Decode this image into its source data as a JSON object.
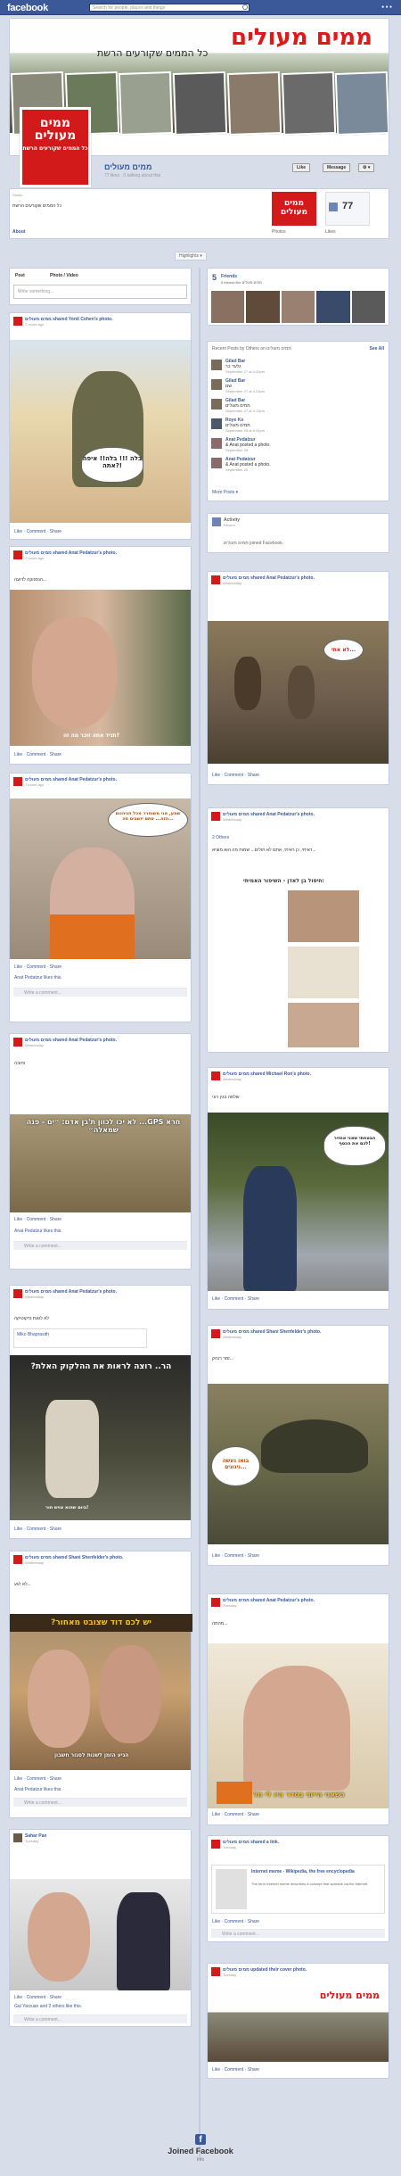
{
  "topbar": {
    "logo": "facebook",
    "search_placeholder": "Search for people, places and things"
  },
  "cover": {
    "title": "ממים מעולים",
    "subtitle": "כל הממים שקורעים הרשת"
  },
  "profile": {
    "line1": "ממים",
    "line2": "מעולים",
    "line3": "כל הממים שקורעים הרשת"
  },
  "page": {
    "name": "ממים מעולים",
    "meta": "77 likes · 0 talking about this",
    "like_btn": "Like",
    "message_btn": "Message",
    "gear": "⚙ ▾",
    "about_label": "About",
    "about_text": "כל הממים שקורעים הרשת",
    "likes_count": "77",
    "photos_label": "Photos",
    "likes_label": "Likes",
    "studio": "Studio"
  },
  "highlights": "Highlights ▾",
  "composer": {
    "tab_post": "Post",
    "tab_photo": "Photo / Video",
    "placeholder": "Write something..."
  },
  "friends": {
    "count": "5",
    "label": "Friends",
    "sub": "5 friends like ממים מעולים"
  },
  "recent": {
    "title": "Recent Posts by Others on ממים מעולים",
    "see_all": "See All",
    "items": [
      {
        "name": "Gilad Bar",
        "text": "גלעד בר",
        "meta": "September 27 at 4:43pm"
      },
      {
        "name": "Gilad Bar",
        "text": "שם",
        "meta": "September 27 at 4:23pm"
      },
      {
        "name": "Gilad Bar",
        "text": "ממים מעולים",
        "meta": "September 27 at 4:13pm"
      },
      {
        "name": "Roye Ko",
        "text": "ממים מעולים",
        "meta": "September 25 at 8:44pm"
      },
      {
        "name": "Anat Pedatzur",
        "text": "& Anat posted a photo.",
        "meta": "September 25"
      },
      {
        "name": "Anat Pedatzur",
        "text": "& Anat posted a photo.",
        "meta": "September 25"
      }
    ],
    "more": "More Posts ▾"
  },
  "activity": {
    "title": "Activity",
    "sub": "Recent",
    "text": "ממים מעולים joined Facebook."
  },
  "posts": [
    {
      "author": "ממים מעולים shared Yonit Cohen's photo.",
      "time": "7 hours ago",
      "bubble": "בלה !!! בלה!! איפה אתה?!",
      "actions": "Like · Comment · Share"
    },
    {
      "author": "ממים מעולים shared Anat Pedatzur's photo.",
      "time": "7 hours ago",
      "text": "הנסנוקה לדועה...",
      "caption": "תגיד אתה זוכר מה זה?",
      "actions": "Like · Comment · Share"
    },
    {
      "author": "ממים מעולים shared Anat Pedatzur's photo.",
      "time": "Wednesday",
      "bubble": "לא אתי...",
      "actions": "Like · Comment · Share"
    },
    {
      "author": "ממים מעולים shared Anat Pedatzur's photo.",
      "time": "7 hours ago",
      "bubble": "שמע, אני משוחרר מכל הגיהנום הזה... סתם יושבים פה...",
      "likes": "Anat Pedatzur likes this.",
      "comment": "Write a comment...",
      "actions": "Like · Comment · Share"
    },
    {
      "author": "ממים מעולים shared Anat Pedatzur's photo.",
      "time": "Wednesday",
      "count": "2 Others",
      "text": "ראיתי, כן ראיתי, אתם לא חולים... שמות מה הוא מוציא...",
      "caption": "חיסול בן לאדן - השיפור האמיתי:",
      "actions": "Like · Comment · Share"
    },
    {
      "author": "ממים מעולים shared Anat Pedatzur's photo.",
      "time": "Wednesday",
      "text": "וחובה",
      "likes": "Anat Pedatzur likes this.",
      "comment": "Write a comment...",
      "caption": "חרא GPS... לא יכו לכוון ת'בן אדם: ״ים - פנה שמאלה״",
      "actions": "Like · Comment · Share"
    },
    {
      "author": "ממים מעולים shared Michael Ron's photo.",
      "time": "Wednesday",
      "text": "שלמה בגין רוני",
      "bubble": "הבטחתי שאני אחזיר לכם את הכסף!",
      "actions": "Like · Comment · Share"
    },
    {
      "author": "ממים מעולים shared Anat Pedatzur's photo.",
      "time": "Wednesday",
      "text": "לא לגעת נרקוטיקה",
      "sub": "Miko Bhaprasith",
      "caption": "הר.. רוצה לראות את ההלקוק האלת?",
      "bottom": "ביום שהוא צויש חור!",
      "actions": "Like · Comment · Share"
    },
    {
      "author": "ממים מעולים shared Shani Shenfelder's photo.",
      "time": "Wednesday",
      "text": "זמר רנהק...",
      "bubble": "בואו נעשה ניגונים...",
      "actions": "Like · Comment · Share"
    },
    {
      "author": "ממים מעולים shared Shani Shenfelder's photo.",
      "time": "Wednesday",
      "text": "לא לגע...",
      "caption": "יש לכם דוד שצובט מאחור?",
      "bottom": "הגיע הזמן לשנות לסגור חשבון",
      "likes": "Anat Pedatzur likes this.",
      "comment": "Write a comment...",
      "actions": "Like · Comment · Share"
    },
    {
      "author": "ממים מעולים shared Anat Pedatzur's photo.",
      "time": "Tuesday",
      "text": "מהמה...",
      "caption": "כשאני הייתי בסדר היו לי תל",
      "actions": "Like · Comment · Share"
    },
    {
      "author": "ממים מעולים shared a link.",
      "time": "Tuesday",
      "title": "Internet meme - Wikipedia, the free encyclopedia",
      "desc": "The term Internet meme describes a concept that spreads via the Internet.",
      "comment": "Write a comment...",
      "actions": "Like · Comment · Share"
    },
    {
      "author": "ממים מעולים",
      "time": "Tuesday",
      "name": "Sahar Pan",
      "likes": "Gal Yarzuan and 2 others like this.",
      "comment": "Write a comment...",
      "actions": "Like · Comment · Share"
    },
    {
      "author": "ממים מעולים updated their cover photo.",
      "time": "Tuesday",
      "cover": "ממים מעולים",
      "actions": "Like · Comment · Share"
    }
  ],
  "footer": {
    "title": "Joined Facebook",
    "sub": "Info"
  },
  "colors": {
    "facebook_blue": "#3b5998",
    "brand_red": "#d21a1a"
  }
}
